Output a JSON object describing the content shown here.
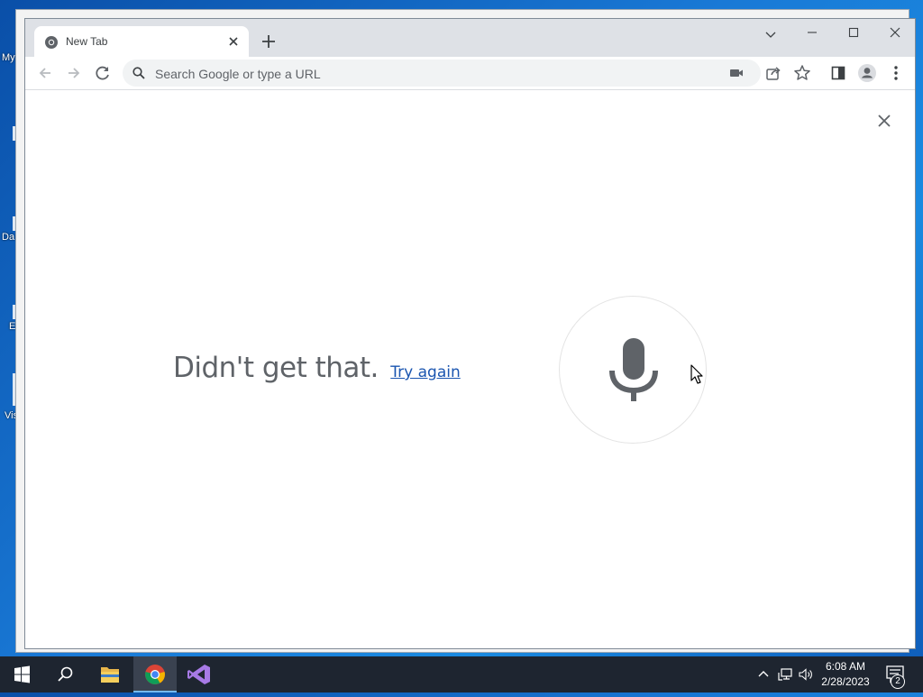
{
  "desktop": {
    "icon_labels": [
      "My",
      "Da",
      "E",
      "Vis"
    ]
  },
  "browser": {
    "tab": {
      "title": "New Tab"
    },
    "omnibox": {
      "placeholder": "Search Google or type a URL",
      "value": ""
    }
  },
  "voice_search": {
    "message": "Didn't get that.",
    "retry_link": "Try again"
  },
  "taskbar": {
    "time": "6:08 AM",
    "date": "2/28/2023",
    "notification_count": "2"
  },
  "colors": {
    "link": "#1a55b0",
    "mic": "#5f6368",
    "taskbar": "#1e2530"
  }
}
